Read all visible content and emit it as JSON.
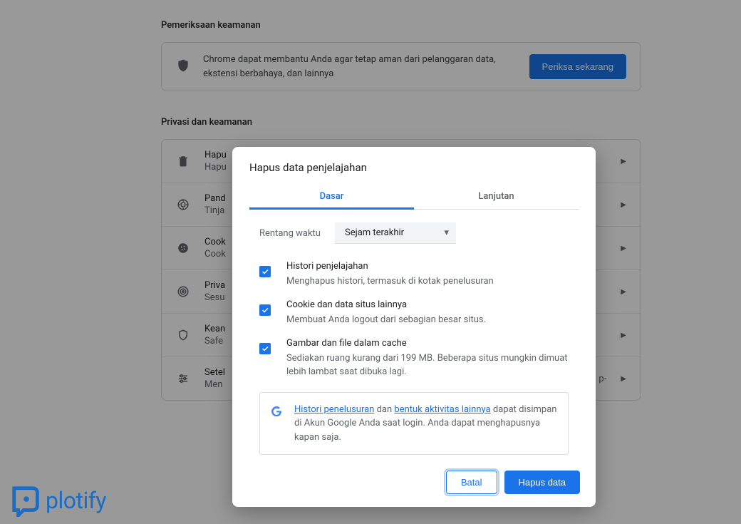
{
  "background": {
    "safety": {
      "section_title": "Pemeriksaan keamanan",
      "text": "Chrome dapat membantu Anda agar tetap aman dari pelanggaran data, ekstensi berbahaya, dan lainnya",
      "button": "Periksa sekarang"
    },
    "privacy": {
      "section_title": "Privasi dan keamanan",
      "rows": [
        {
          "icon": "trash-icon",
          "title": "Hapu",
          "sub": "Hapu"
        },
        {
          "icon": "target-icon",
          "title": "Pand",
          "sub": "Tinja"
        },
        {
          "icon": "cookie-icon",
          "title": "Cook",
          "sub": "Cook"
        },
        {
          "icon": "radar-icon",
          "title": "Priva",
          "sub": "Sesu"
        },
        {
          "icon": "shield-icon",
          "title": "Kean",
          "sub": "Safe"
        },
        {
          "icon": "sliders-icon",
          "title": "Setel",
          "sub": "Men"
        }
      ],
      "row5_tail": "p-"
    }
  },
  "dialog": {
    "title": "Hapus data penjelajahan",
    "tabs": {
      "basic": "Dasar",
      "advanced": "Lanjutan"
    },
    "time": {
      "label": "Rentang waktu",
      "value": "Sejam terakhir"
    },
    "items": [
      {
        "title": "Histori penjelajahan",
        "sub": "Menghapus histori, termasuk di kotak penelusuran"
      },
      {
        "title": "Cookie dan data situs lainnya",
        "sub": "Membuat Anda logout dari sebagian besar situs."
      },
      {
        "title": "Gambar dan file dalam cache",
        "sub": "Sediakan ruang kurang dari 199 MB. Beberapa situs mungkin dimuat lebih lambat saat dibuka lagi."
      }
    ],
    "info": {
      "link1": "Histori penelusuran",
      "mid1": " dan ",
      "link2": "bentuk aktivitas lainnya",
      "rest": " dapat disimpan di Akun Google Anda saat login. Anda dapat menghapusnya kapan saja."
    },
    "actions": {
      "cancel": "Batal",
      "confirm": "Hapus data"
    }
  },
  "watermark": "plotify"
}
